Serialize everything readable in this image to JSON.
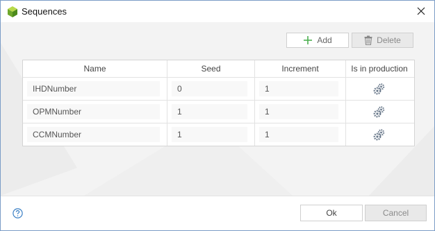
{
  "window": {
    "title": "Sequences",
    "app_icon": "green-cube-icon",
    "close_icon": "close-x-icon"
  },
  "toolbar": {
    "add_label": "Add",
    "add_icon": "plus-icon",
    "delete_label": "Delete",
    "delete_icon": "trash-icon",
    "delete_disabled": true
  },
  "table": {
    "columns": [
      "Name",
      "Seed",
      "Increment",
      "Is in production"
    ],
    "rows": [
      {
        "name": "IHDNumber",
        "seed": "0",
        "increment": "1",
        "production_icon": "gears-icon"
      },
      {
        "name": "OPMNumber",
        "seed": "1",
        "increment": "1",
        "production_icon": "gears-icon"
      },
      {
        "name": "CCMNumber",
        "seed": "1",
        "increment": "1",
        "production_icon": "gears-icon"
      }
    ]
  },
  "footer": {
    "help_icon": "help-circle-icon",
    "ok_label": "Ok",
    "cancel_label": "Cancel",
    "cancel_disabled": true
  },
  "colors": {
    "add_plus": "#4caf50",
    "gear": "#6b7a8c",
    "window_border": "#7a9cc6",
    "help": "#3a7fc4"
  }
}
